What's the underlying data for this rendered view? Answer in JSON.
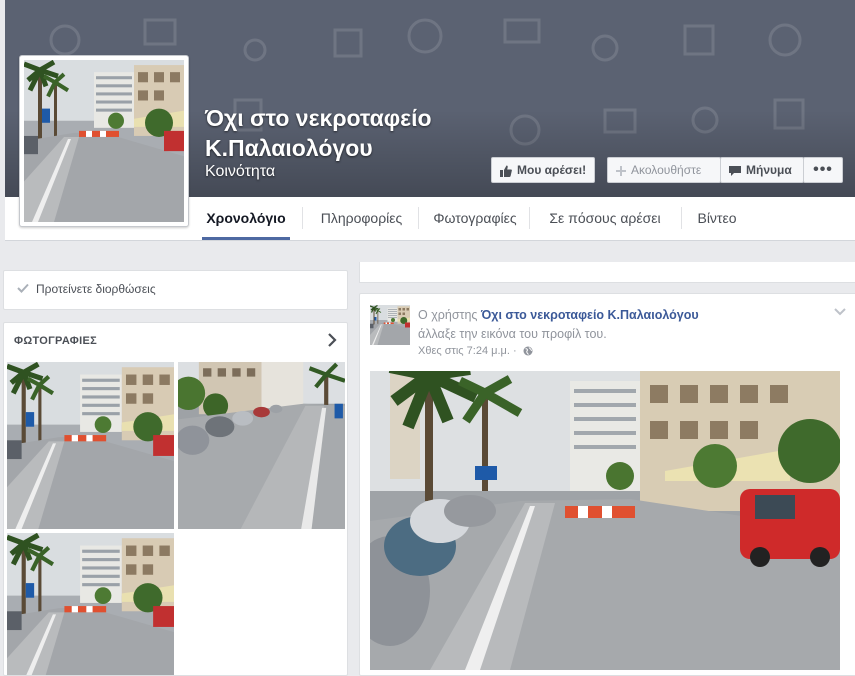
{
  "page": {
    "title_line1": "Όχι στο νεκροταφείο",
    "title_line2": "Κ.Παλαιολόγου",
    "category": "Κοινότητα"
  },
  "actions": {
    "like_label": "Μου αρέσει!",
    "follow_label": "Ακολουθήστε",
    "message_label": "Μήνυμα",
    "more_label": "•••"
  },
  "tabs": [
    {
      "label": "Χρονολόγιο",
      "active": true
    },
    {
      "label": "Πληροφορίες",
      "active": false
    },
    {
      "label": "Φωτογραφίες",
      "active": false
    },
    {
      "label": "Σε πόσους αρέσει",
      "active": false
    },
    {
      "label": "Βίντεο",
      "active": false
    }
  ],
  "sidebar": {
    "suggest_edits": "Προτείνετε διορθώσεις",
    "photos_header": "ΦΩΤΟΓΡΑΦΙΕΣ"
  },
  "post": {
    "prefix": "Ο χρήστης",
    "author": "Όχι στο νεκροταφείο Κ.Παλαιολόγου",
    "action": "άλλαξε την εικόνα του προφίλ του.",
    "timestamp": "Χθες στις 7:24 μ.μ. ·"
  },
  "colors": {
    "cover": "#5b6272",
    "link": "#3b5998",
    "tab_active": "#4e69a2",
    "background": "#e9eaed"
  },
  "icons": {
    "like": "thumbs-up-icon",
    "follow": "plus-icon",
    "message": "speech-bubble-icon",
    "suggest": "checkmark-icon",
    "photos_more": "chevron-right-icon",
    "privacy": "globe-icon",
    "post_menu": "chevron-down-icon"
  }
}
